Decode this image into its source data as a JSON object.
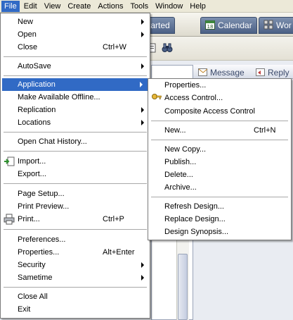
{
  "menubar": {
    "items": [
      "File",
      "Edit",
      "View",
      "Create",
      "Actions",
      "Tools",
      "Window",
      "Help"
    ]
  },
  "tabs": {
    "getting_started": "tting Started",
    "calendar": "Calendar",
    "workspace": "Wor"
  },
  "workspace": {
    "message_tab": "Message",
    "reply_tab": "Reply"
  },
  "file_menu": {
    "new": "New",
    "open": "Open",
    "close": "Close",
    "close_shortcut": "Ctrl+W",
    "autosave": "AutoSave",
    "application": "Application",
    "make_offline": "Make Available Offline...",
    "replication": "Replication",
    "locations": "Locations",
    "open_chat": "Open Chat History...",
    "import": "Import...",
    "export": "Export...",
    "page_setup": "Page Setup...",
    "print_preview": "Print Preview...",
    "print": "Print...",
    "print_shortcut": "Ctrl+P",
    "preferences": "Preferences...",
    "properties": "Properties...",
    "properties_shortcut": "Alt+Enter",
    "security": "Security",
    "sametime": "Sametime",
    "close_all": "Close All",
    "exit": "Exit"
  },
  "application_submenu": {
    "properties": "Properties...",
    "access_control": "Access Control...",
    "composite_access_control": "Composite Access Control",
    "new": "New...",
    "new_shortcut": "Ctrl+N",
    "new_copy": "New Copy...",
    "publish": "Publish...",
    "delete": "Delete...",
    "archive": "Archive...",
    "refresh_design": "Refresh Design...",
    "replace_design": "Replace Design...",
    "design_synopsis": "Design Synopsis..."
  },
  "colors": {
    "highlight": "#316ac5",
    "menubar": "#ece9d8"
  }
}
